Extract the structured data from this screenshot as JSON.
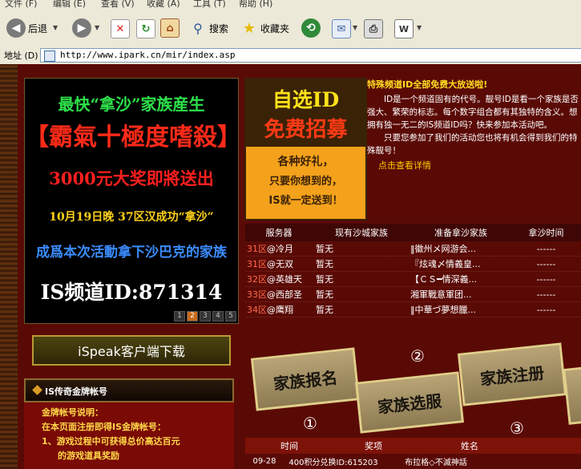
{
  "menu": {
    "items": [
      "文件 (F)",
      "编辑 (E)",
      "查看 (V)",
      "收藏 (A)",
      "工具 (T)",
      "帮助 (H)"
    ]
  },
  "toolbar": {
    "back_label": "后退",
    "search_label": "搜索",
    "favorites_label": "收藏夹"
  },
  "address": {
    "label": "地址 (D)",
    "url": "http://www.ipark.cn/mir/index.asp"
  },
  "banner_left": {
    "line1": "最快“拿沙”家族産生",
    "line2": "【霸氣十極度嗜殺】",
    "line3": "3000元大奖即將送出",
    "line4": "10月19日晚 37区汉成功“拿沙”",
    "line5": "成爲本次活動拿下沙巴克的家族",
    "line6": "IS频道ID:871314",
    "pages": [
      "1",
      "2",
      "3",
      "4",
      "5"
    ],
    "active_page": "2"
  },
  "banner_right": {
    "title1": "自选ID",
    "title2": "免费招募",
    "lines": [
      "各种好礼，",
      "只要你想到的，",
      "IS就一定送到！"
    ]
  },
  "info": {
    "title": "特殊频道ID全部免费大放送啦!",
    "p1": "ID是一个频道固有的代号。靓号ID是看一个家族是否强大、繁荣的标志。每个数字组合都有其独特的含义。想拥有独一无二的IS频道ID吗？快来参加本活动吧。",
    "p2": "只要您参加了我们的活动您也将有机会得到我们的特殊靓号！",
    "link": "点击查看详情"
  },
  "server_table": {
    "headers": [
      "服务器",
      "现有沙城家族",
      "准备拿沙家族",
      "拿沙时间"
    ],
    "rows": [
      {
        "zone": "31区",
        "name": "@冷月",
        "current": "暂无",
        "prepare": "‖徽州メ网游会...",
        "time": "------"
      },
      {
        "zone": "31区",
        "name": "@无双",
        "current": "暂无",
        "prepare": "『炫魂〆情義皇...",
        "time": "------"
      },
      {
        "zone": "32区",
        "name": "@英雄天",
        "current": "暂无",
        "prepare": "【ＣＳ━情深義...",
        "time": "------"
      },
      {
        "zone": "33区",
        "name": "@西部圣",
        "current": "暂无",
        "prepare": "湘軍戰意軍团...",
        "time": "------"
      },
      {
        "zone": "34区",
        "name": "@鹰翔",
        "current": "暂无",
        "prepare": "‖中華づ夢想臘...",
        "time": "------"
      }
    ]
  },
  "download_button": "iSpeak客户端下载",
  "account": {
    "header": "IS传奇金牌帐号",
    "lines": [
      "金牌帐号说明：",
      "在本页面注册即得IS金牌帐号：",
      "1、游戏过程中可获得总价高达百元",
      "的游戏道具奖励"
    ]
  },
  "blocks": {
    "b1": "家族报名",
    "b2": "家族选服",
    "b3": "家族注册",
    "n1": "①",
    "n2": "②",
    "n3": "③"
  },
  "prize_table": {
    "headers": [
      "时间",
      "奖项",
      "姓名",
      ""
    ],
    "rows": [
      {
        "time": "09-28",
        "prize": "400积分兑换ID:615203",
        "name": "布拉格◇不滅神話",
        "extra": ""
      }
    ]
  }
}
